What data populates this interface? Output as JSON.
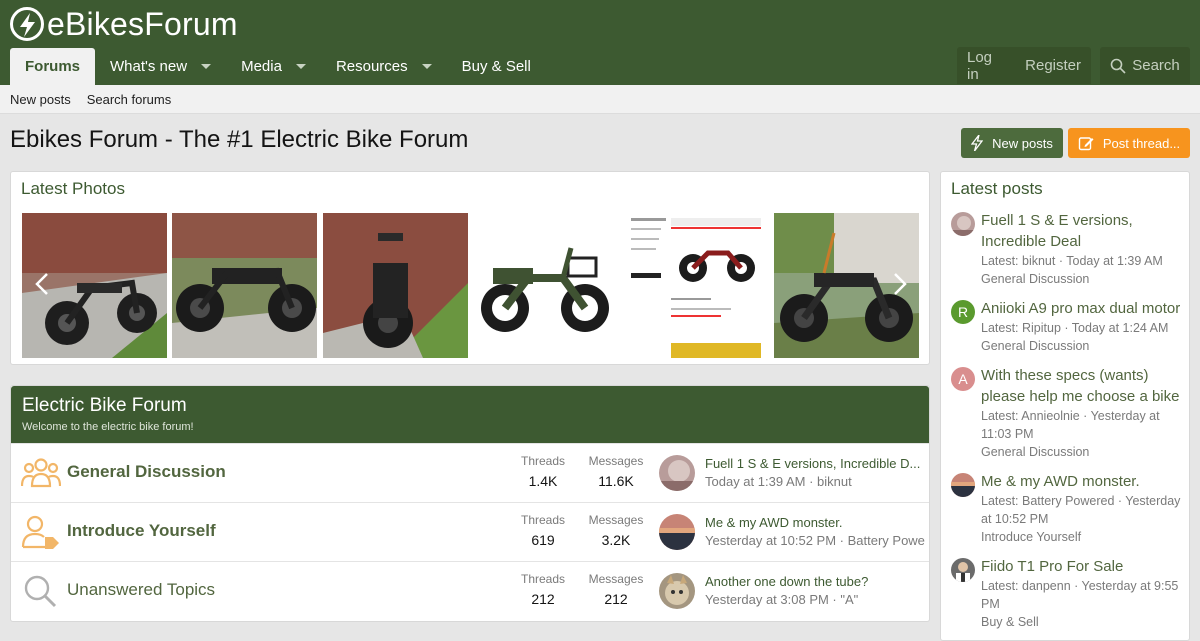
{
  "site": {
    "name": "eBikesForum"
  },
  "nav": {
    "tabs": [
      {
        "label": "Forums"
      },
      {
        "label": "What's new"
      },
      {
        "label": "Media"
      },
      {
        "label": "Resources"
      },
      {
        "label": "Buy & Sell"
      }
    ]
  },
  "account": {
    "login": "Log in",
    "register": "Register",
    "search": "Search"
  },
  "subnav": {
    "new_posts": "New posts",
    "search_forums": "Search forums"
  },
  "page": {
    "title": "Ebikes Forum - The #1 Electric Bike Forum"
  },
  "buttons": {
    "new_posts": "New posts",
    "post_thread": "Post thread..."
  },
  "photos": {
    "heading": "Latest Photos"
  },
  "forum": {
    "title": "Electric Bike Forum",
    "description": "Welcome to the electric bike forum!",
    "nodes": [
      {
        "title": "General Discussion",
        "threads_label": "Threads",
        "threads": "1.4K",
        "messages_label": "Messages",
        "messages": "11.6K",
        "last_title": "Fuell 1 S & E versions, Incredible D...",
        "last_meta": "Today at 1:39 AM · biknut"
      },
      {
        "title": "Introduce Yourself",
        "threads_label": "Threads",
        "threads": "619",
        "messages_label": "Messages",
        "messages": "3.2K",
        "last_title": "Me & my AWD monster.",
        "last_meta": "Yesterday at 10:52 PM · Battery Powe"
      },
      {
        "title": "Unanswered Topics",
        "threads_label": "Threads",
        "threads": "212",
        "messages_label": "Messages",
        "messages": "212",
        "last_title": "Another one down the tube?",
        "last_meta": "Yesterday at 3:08 PM · \"A\""
      }
    ]
  },
  "latest_posts": {
    "heading": "Latest posts",
    "items": [
      {
        "title": "Fuell 1 S & E versions, Incredible Deal",
        "meta": "Latest: biknut · Today at 1:39 AM",
        "node": "General Discussion"
      },
      {
        "title": "Aniioki A9 pro max dual motor",
        "meta": "Latest: Ripitup · Today at 1:24 AM",
        "node": "General Discussion",
        "avatar_letter": "R"
      },
      {
        "title": "With these specs (wants) please help me choose a bike",
        "meta": "Latest: Annieolnie · Yesterday at 11:03 PM",
        "node": "General Discussion",
        "avatar_letter": "A"
      },
      {
        "title": "Me & my AWD monster.",
        "meta": "Latest: Battery Powered · Yesterday at 10:52 PM",
        "node": "Introduce Yourself"
      },
      {
        "title": "Fiido T1 Pro For Sale",
        "meta": "Latest: danpenn · Yesterday at 9:55 PM",
        "node": "Buy & Sell"
      }
    ]
  },
  "colors": {
    "brand": "#3d5a31",
    "accent": "#f7941e",
    "avatar_green": "#5a9a2e",
    "avatar_pink": "#d98e8e"
  }
}
